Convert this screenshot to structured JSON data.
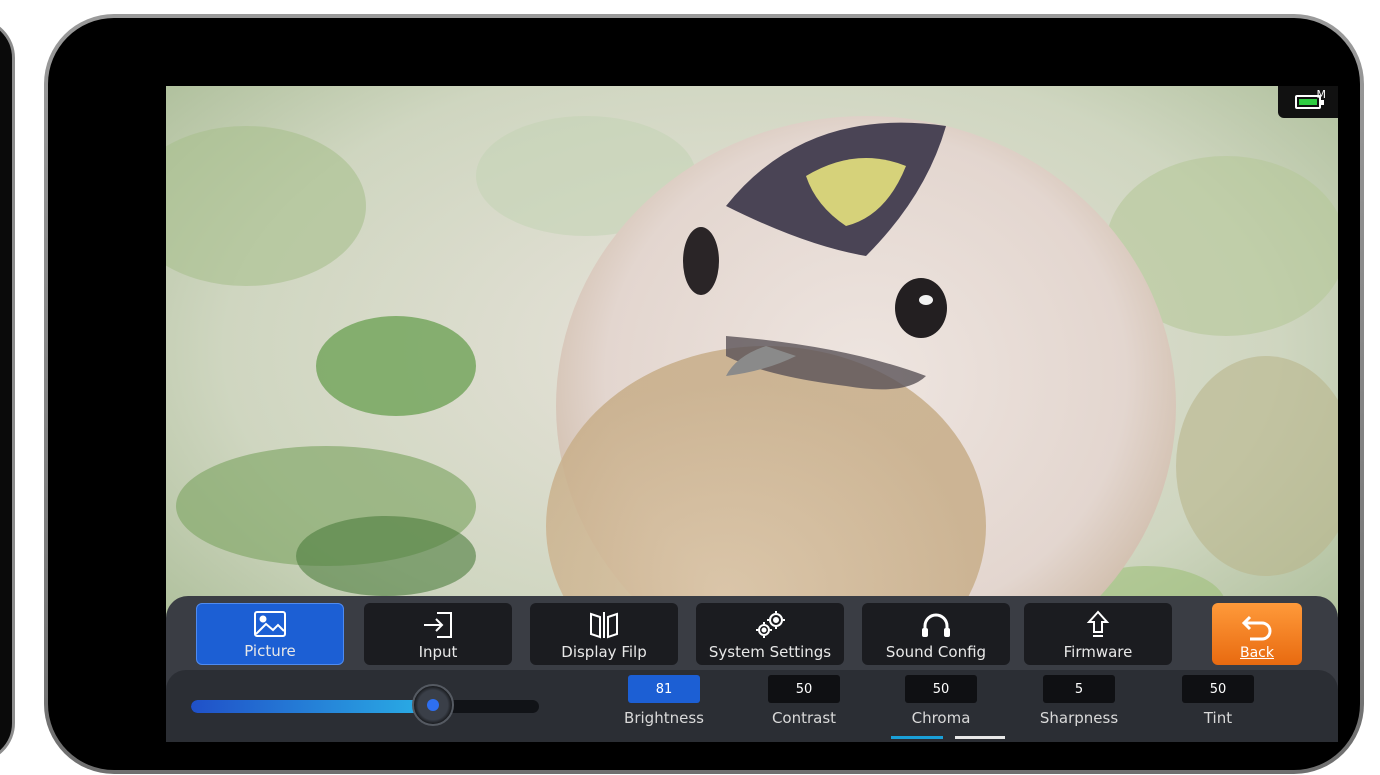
{
  "status": {
    "battery_mode": "M"
  },
  "tabs": [
    {
      "label": "Picture",
      "icon": "image-icon",
      "active": true
    },
    {
      "label": "Input",
      "icon": "input-icon",
      "active": false
    },
    {
      "label": "Display Filp",
      "icon": "display-flip-icon",
      "active": false
    },
    {
      "label": "System Settings",
      "icon": "gears-icon",
      "active": false
    },
    {
      "label": "Sound Config",
      "icon": "headphones-icon",
      "active": false
    },
    {
      "label": "Firmware",
      "icon": "upload-arrow-icon",
      "active": false
    }
  ],
  "back": {
    "label": "Back",
    "icon": "back-arrow-icon"
  },
  "slider": {
    "value": 81,
    "max": 100
  },
  "params": [
    {
      "name": "Brightness",
      "value": "81",
      "active": true
    },
    {
      "name": "Contrast",
      "value": "50",
      "active": false
    },
    {
      "name": "Chroma",
      "value": "50",
      "active": false
    },
    {
      "name": "Sharpness",
      "value": "5",
      "active": false
    },
    {
      "name": "Tint",
      "value": "50",
      "active": false
    }
  ],
  "colors": {
    "accent": "#1c5fd4",
    "back": "#f07e20",
    "panel": "#3a3d44"
  }
}
